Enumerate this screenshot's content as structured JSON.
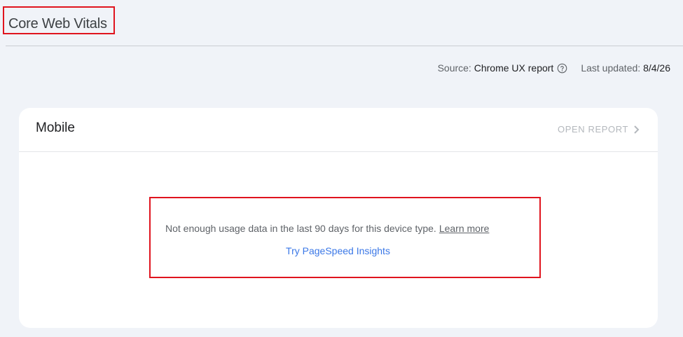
{
  "header": {
    "title": "Core Web Vitals"
  },
  "meta": {
    "source_label": "Source:",
    "source_value": "Chrome UX report",
    "updated_label": "Last updated:",
    "updated_value": "8/4/26"
  },
  "card": {
    "title": "Mobile",
    "open_report_label": "OPEN REPORT",
    "notice": "Not enough usage data in the last 90 days for this device type.",
    "learn_more_label": "Learn more",
    "pagespeed_label": "Try PageSpeed Insights"
  },
  "colors": {
    "background": "#f0f3f8",
    "highlight_border": "#e0141e",
    "link_blue": "#3b78e7",
    "disabled_text": "#b4b8bd"
  },
  "icons": {
    "help": "help-circle-icon",
    "chevron": "chevron-right-icon"
  }
}
